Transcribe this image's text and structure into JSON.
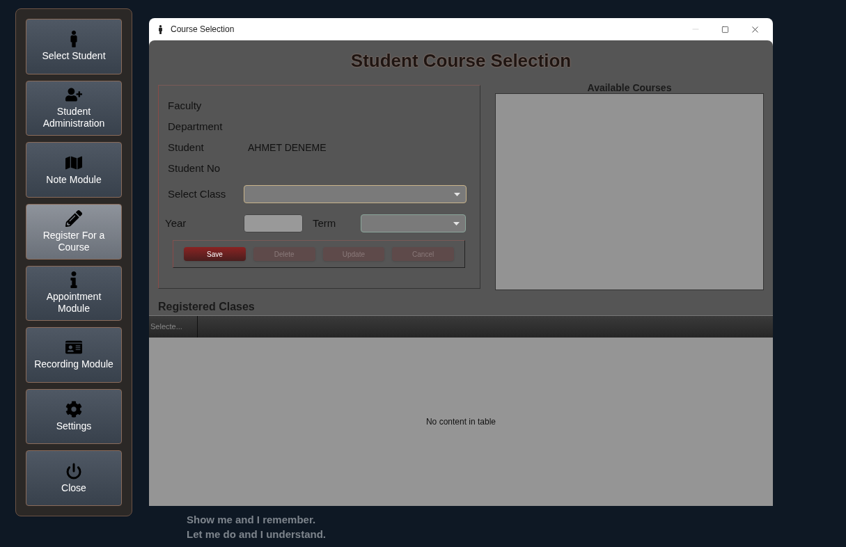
{
  "sidebar": {
    "items": [
      {
        "label": "Select Student",
        "selected": false
      },
      {
        "label": "Student Administration",
        "selected": false
      },
      {
        "label": "Note Module",
        "selected": false
      },
      {
        "label": "Register For a Course",
        "selected": true
      },
      {
        "label": "Appointment Module",
        "selected": false
      },
      {
        "label": "Recording Module",
        "selected": false
      },
      {
        "label": "Settings",
        "selected": false
      },
      {
        "label": "Close",
        "selected": false
      }
    ]
  },
  "window": {
    "title": "Course Selection"
  },
  "heading": "Student Course Selection",
  "student_info": [
    {
      "label": "Faculty"
    },
    {
      "label": "Department"
    },
    {
      "label": "Student",
      "value": "AHMET DENEME"
    },
    {
      "label": "Student No"
    }
  ],
  "select_class": {
    "label": "Select Class"
  },
  "year": {
    "label": "Year"
  },
  "term": {
    "label": "Term"
  },
  "buttons": [
    {
      "label": "Save",
      "disabled": false
    },
    {
      "label": "Delete",
      "disabled": true
    },
    {
      "label": "Update",
      "disabled": true
    },
    {
      "label": "Cancel",
      "disabled": true
    }
  ],
  "available_courses": {
    "title": "Available Courses"
  },
  "registered": {
    "title": "Registered Clases",
    "columns": [
      "Selecte..."
    ],
    "empty_message": "No content in table"
  },
  "background_quote": [
    "Show me and I remember.",
    "Let me do and I understand."
  ]
}
